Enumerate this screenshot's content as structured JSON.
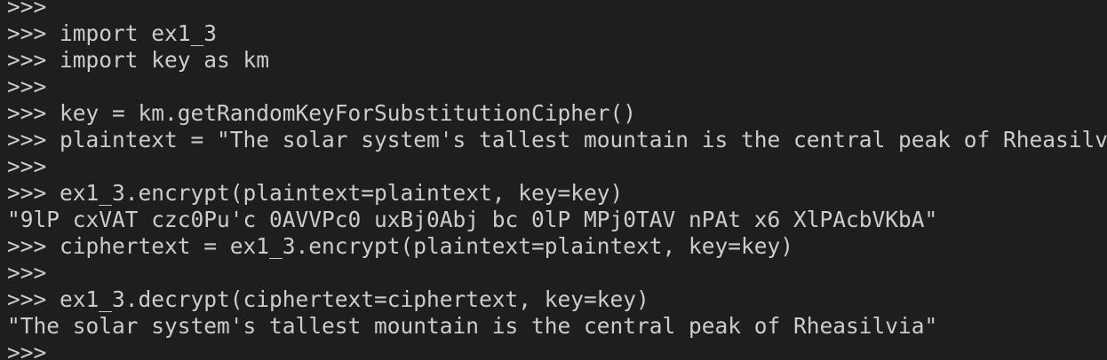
{
  "terminal": {
    "lines": [
      ">>>",
      ">>> import ex1_3",
      ">>> import key as km",
      ">>>",
      ">>> key = km.getRandomKeyForSubstitutionCipher()",
      ">>> plaintext = \"The solar system's tallest mountain is the central peak of Rheasilvia\"",
      ">>>",
      ">>> ex1_3.encrypt(plaintext=plaintext, key=key)",
      "\"9lP cxVAT czc0Pu'c 0AVVPc0 uxBj0Abj bc 0lP MPj0TAV nPAt x6 XlPAcbVKbA\"",
      ">>> ciphertext = ex1_3.encrypt(plaintext=plaintext, key=key)",
      ">>>",
      ">>> ex1_3.decrypt(ciphertext=ciphertext, key=key)",
      "\"The solar system's tallest mountain is the central peak of Rheasilvia\"",
      ">>>"
    ]
  }
}
